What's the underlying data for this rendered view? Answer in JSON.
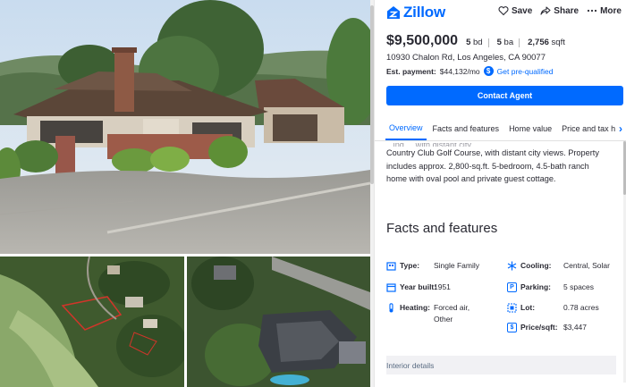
{
  "brand": {
    "name": "Zillow"
  },
  "header": {
    "actions": [
      {
        "label": "Save",
        "icon": "heart-icon"
      },
      {
        "label": "Share",
        "icon": "share-icon"
      },
      {
        "label": "More",
        "icon": "more-icon"
      }
    ]
  },
  "listing": {
    "price": "$9,500,000",
    "beds": "5",
    "beds_unit": "bd",
    "baths": "5",
    "baths_unit": "ba",
    "sqft": "2,756",
    "sqft_unit": "sqft",
    "address": "10930 Chalon Rd, Los Angeles, CA 90077",
    "est_payment_label": "Est. payment:",
    "est_payment_value": "$44,132/mo",
    "prequal_label": "Get pre-qualified",
    "contact_button": "Contact Agent"
  },
  "tabs": [
    {
      "label": "Overview",
      "active": true
    },
    {
      "label": "Facts and features",
      "active": false
    },
    {
      "label": "Home value",
      "active": false
    },
    {
      "label": "Price and tax hist",
      "active": false
    }
  ],
  "description": {
    "faded_line": "...ing ... with distant city ...",
    "lines": [
      "Country Club Golf Course, with distant city views. Property",
      "includes approx. 2,800-sq.ft. 5-bedroom, 4.5-bath ranch",
      "home with oval pool and private guest cottage."
    ]
  },
  "facts_section": {
    "title": "Facts and features",
    "items": [
      {
        "label": "Type:",
        "value": "Single Family",
        "icon": "building-icon"
      },
      {
        "label": "Cooling:",
        "value": "Central, Solar",
        "icon": "snowflake-icon"
      },
      {
        "label": "Year built:",
        "value": "1951",
        "icon": "calendar-icon"
      },
      {
        "label": "Parking:",
        "value": "5 spaces",
        "icon": "parking-icon",
        "icon_text": "P"
      },
      {
        "label": "Heating:",
        "value_line1": "Forced air,",
        "value_line2": "Other",
        "icon": "thermometer-icon"
      },
      {
        "label": "Lot:",
        "value": "0.78 acres",
        "icon": "lot-icon"
      },
      {
        "label": "Price/sqft:",
        "value": "$3,447",
        "icon": "price-tag-icon",
        "icon_text": "$"
      }
    ]
  },
  "interior": {
    "label": "Interior details"
  },
  "colors": {
    "brand_blue": "#006aff",
    "text": "#2a2a33"
  }
}
